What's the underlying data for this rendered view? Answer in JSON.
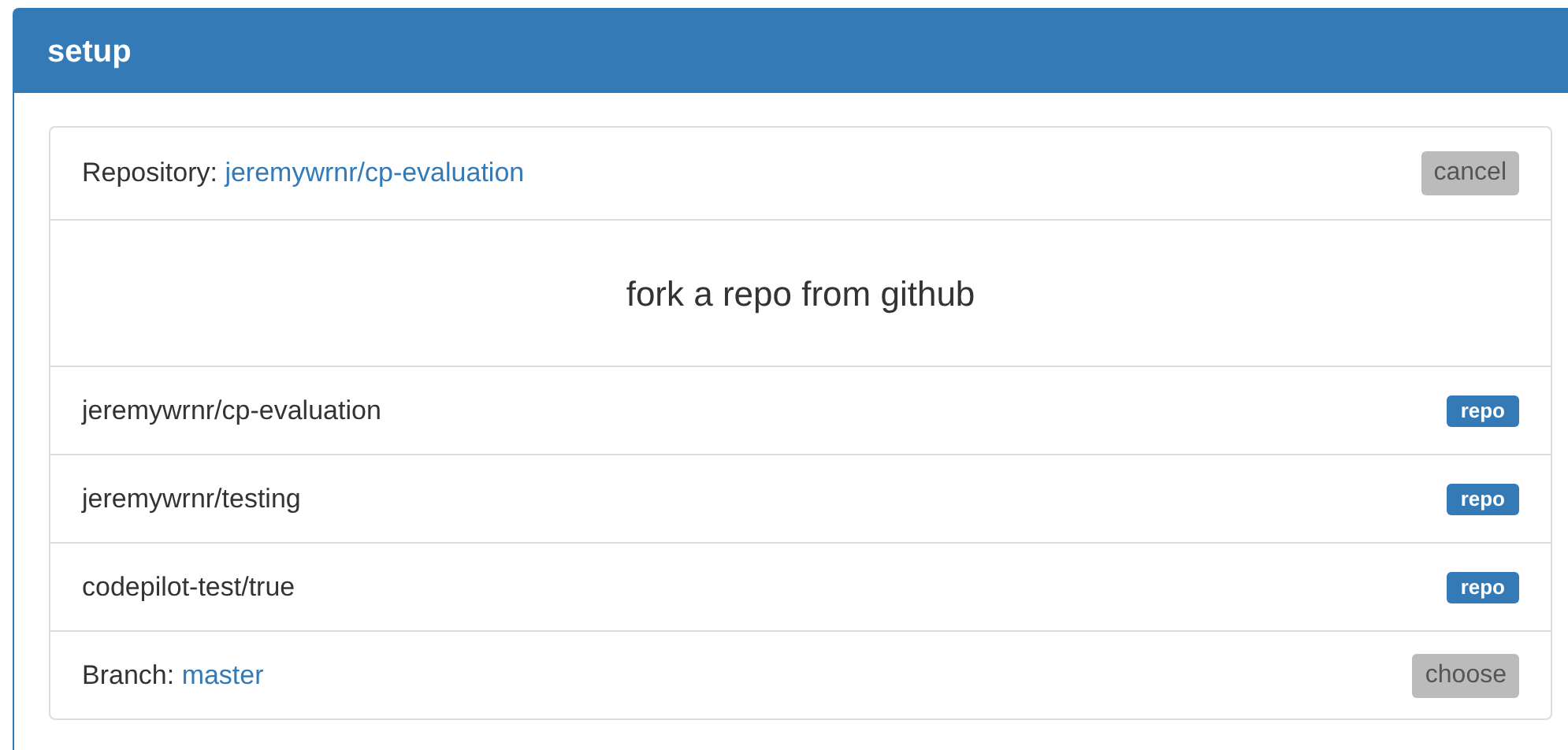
{
  "panel": {
    "title": "setup"
  },
  "repository": {
    "label": "Repository:",
    "value": "jeremywrnr/cp-evaluation",
    "button": "cancel"
  },
  "heading": "fork a repo from github",
  "repos": [
    {
      "name": "jeremywrnr/cp-evaluation",
      "tag": "repo"
    },
    {
      "name": "jeremywrnr/testing",
      "tag": "repo"
    },
    {
      "name": "codepilot-test/true",
      "tag": "repo"
    }
  ],
  "branch": {
    "label": "Branch:",
    "value": "master",
    "button": "choose"
  }
}
